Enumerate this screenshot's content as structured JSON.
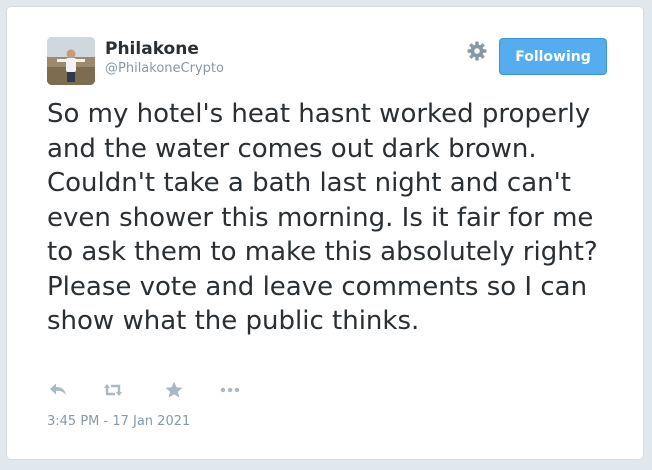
{
  "user": {
    "name": "Philakone",
    "handle": "@PhilakoneCrypto"
  },
  "follow_button": {
    "label": "Following"
  },
  "tweet": {
    "text": "So my hotel's heat hasnt worked properly and the water comes out dark brown. Couldn't take a bath last night and can't even shower this morning. Is it fair for me to ask them to make this absolutely right? Please vote and leave comments so I can show what the public thinks.",
    "timestamp": "3:45 PM - 17 Jan 2021"
  },
  "icons": {
    "settings": "gear-icon",
    "reply": "reply-icon",
    "retweet": "retweet-icon",
    "favorite": "star-icon",
    "more": "more-icon"
  },
  "colors": {
    "button_bg": "#55acee",
    "text": "#292f33",
    "muted": "#8899a6",
    "icon": "#aab8c2"
  }
}
